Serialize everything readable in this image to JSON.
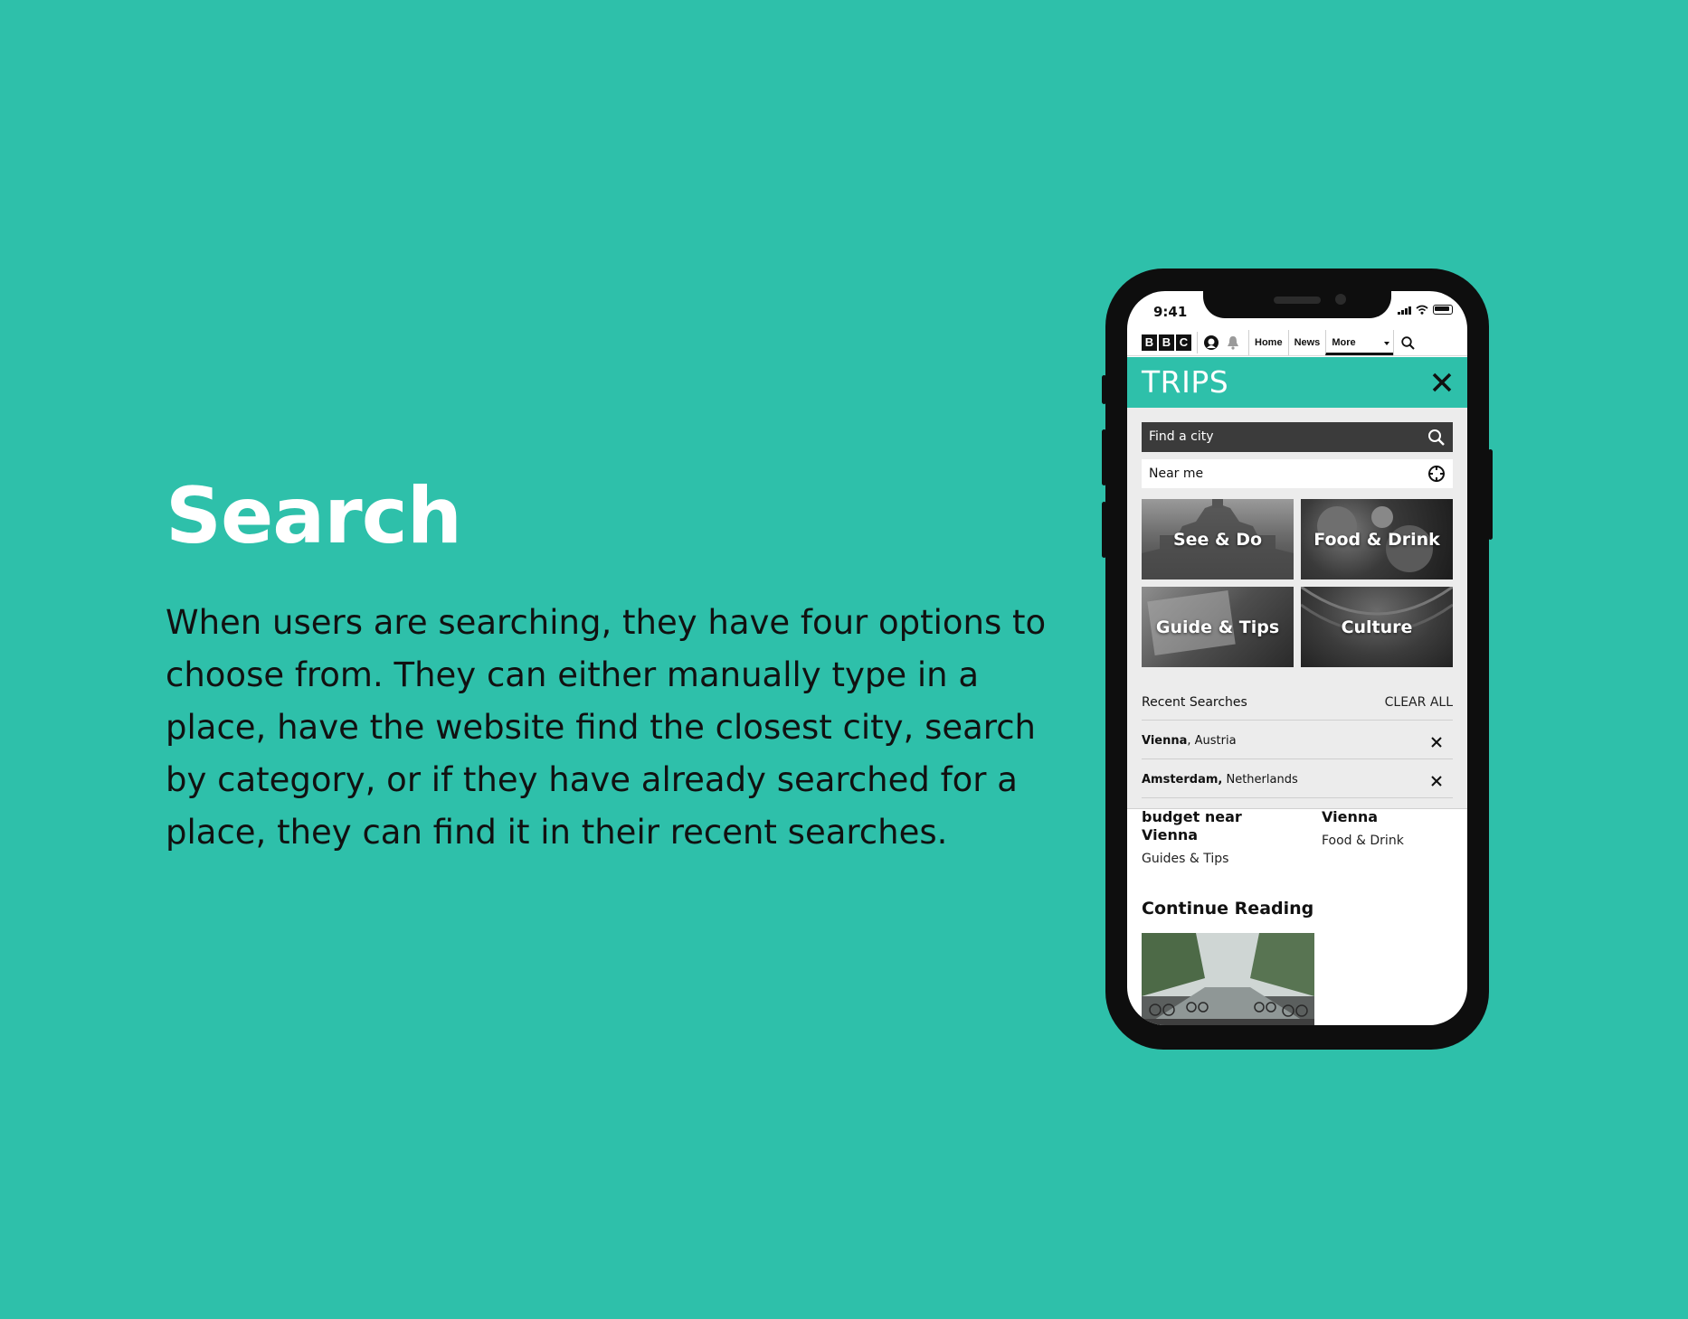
{
  "slide": {
    "title": "Search",
    "description": "When users are searching, they have four options to choose from. They can either manually type in a place, have the website find the closest city, search by category, or if they have already searched for a place, they can find it in their recent searches."
  },
  "status_bar": {
    "time": "9:41"
  },
  "bbc_nav": {
    "logo": [
      "B",
      "B",
      "C"
    ],
    "links": [
      "Home",
      "News",
      "More"
    ]
  },
  "trips": {
    "title": "TRIPS",
    "search": {
      "placeholder": "Find a city",
      "near_me": "Near me"
    },
    "categories": [
      "See & Do",
      "Food & Drink",
      "Guide & Tips",
      "Culture"
    ],
    "recent": {
      "header": "Recent Searches",
      "clear_label": "CLEAR ALL",
      "items": [
        {
          "city": "Vienna",
          "country": ", Austria"
        },
        {
          "city": "Amsterdam,",
          "country": " Netherlands"
        }
      ]
    },
    "articles": [
      {
        "title": "budget near Vienna",
        "category": "Guides & Tips"
      },
      {
        "title": "Vienna",
        "category": "Food & Drink"
      }
    ],
    "continue_reading": "Continue Reading"
  },
  "colors": {
    "accent": "#2ec0aa",
    "panel": "#ececec",
    "field_dark": "#3b3b3b"
  }
}
